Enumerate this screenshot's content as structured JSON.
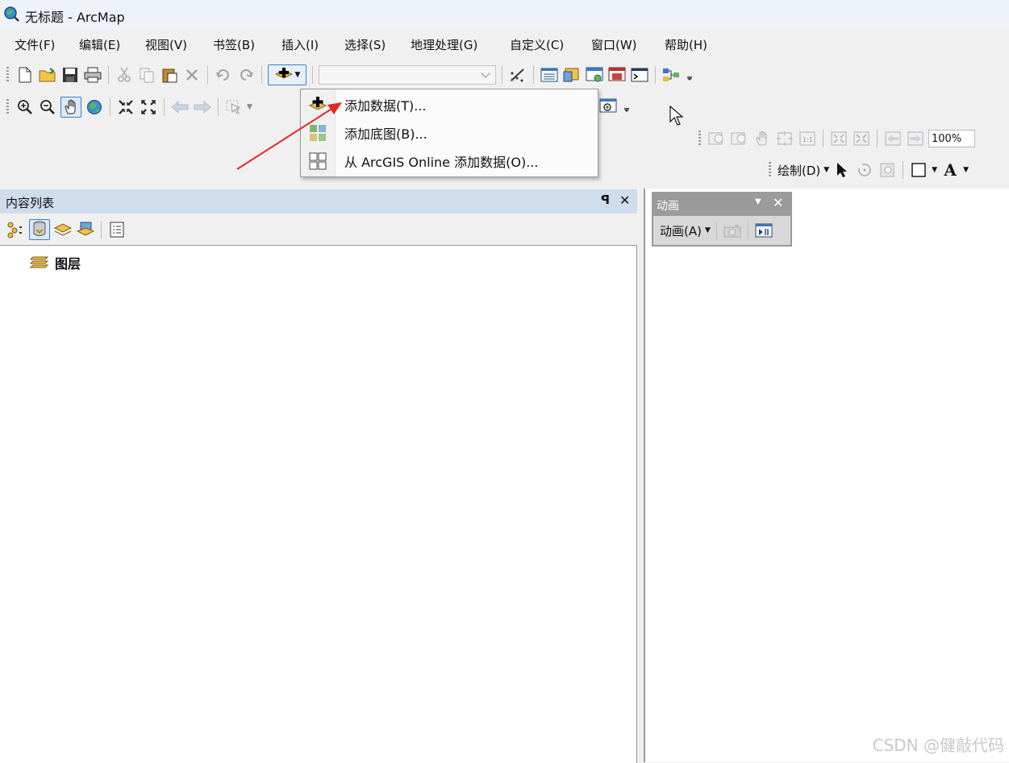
{
  "window": {
    "title": "无标题 - ArcMap"
  },
  "menu": [
    "文件(F)",
    "编辑(E)",
    "视图(V)",
    "书签(B)",
    "插入(I)",
    "选择(S)",
    "地理处理(G)",
    "自定义(C)",
    "窗口(W)",
    "帮助(H)"
  ],
  "dropdown": {
    "items": [
      {
        "label": "添加数据(T)...",
        "icon": "add-data-icon"
      },
      {
        "label": "添加底图(B)...",
        "icon": "add-basemap-icon"
      },
      {
        "label": "从 ArcGIS Online 添加数据(O)...",
        "icon": "arcgis-online-icon"
      }
    ]
  },
  "layout_toolbar": {
    "zoom_value": "100%"
  },
  "draw_toolbar": {
    "label": "绘制(D)"
  },
  "toc": {
    "title": "内容列表",
    "layer_root": "图层",
    "pin": "ᵖ",
    "close": "✕"
  },
  "animation": {
    "title": "动画",
    "menu_label": "动画(A)"
  },
  "watermark": "CSDN @健敲代码",
  "colors": {
    "toc_header": "#cfdcec",
    "title_bar": "#eef2f9",
    "arrow": "#e02a2a"
  }
}
